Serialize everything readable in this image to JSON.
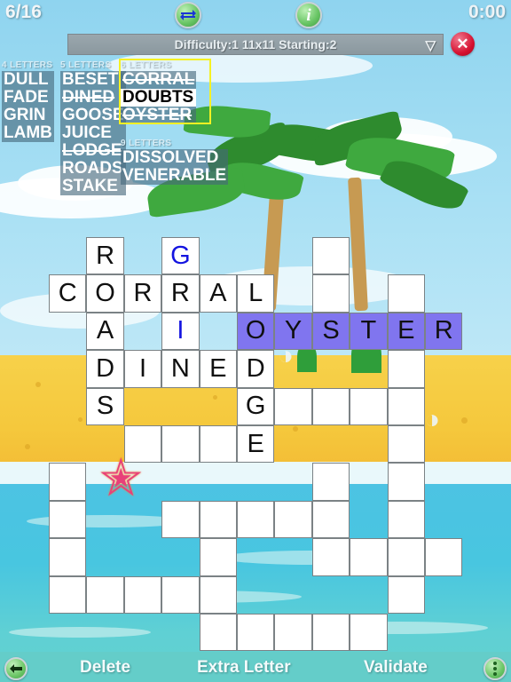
{
  "hud": {
    "progress": "6/16",
    "timer": "0:00",
    "swap_icon": "swap-arrows-icon",
    "info_icon": "info-icon",
    "info_glyph": "i",
    "close_icon": "close-icon",
    "close_glyph": "✕"
  },
  "dropdown": {
    "label": "Difficulty:1   11x11   Starting:2",
    "caret": "▽"
  },
  "wordbank": {
    "groups": [
      {
        "header": "4 LETTERS",
        "words": [
          {
            "text": "DULL",
            "used": false,
            "current": false
          },
          {
            "text": "FADE",
            "used": false,
            "current": false
          },
          {
            "text": "GRIN",
            "used": false,
            "current": false
          },
          {
            "text": "LAMB",
            "used": false,
            "current": false
          }
        ]
      },
      {
        "header": "5 LETTERS",
        "words": [
          {
            "text": "BESET",
            "used": false,
            "current": false
          },
          {
            "text": "DINED",
            "used": true,
            "current": false
          },
          {
            "text": "GOOSE",
            "used": false,
            "current": false
          },
          {
            "text": "JUICE",
            "used": false,
            "current": false
          },
          {
            "text": "LODGE",
            "used": true,
            "current": false
          },
          {
            "text": "ROADS",
            "used": false,
            "current": false
          },
          {
            "text": "STAKE",
            "used": false,
            "current": false
          }
        ]
      },
      {
        "header": "6 LETTERS",
        "words": [
          {
            "text": "CORRAL",
            "used": true,
            "current": false
          },
          {
            "text": "DOUBTS",
            "used": false,
            "current": true
          },
          {
            "text": "OYSTER",
            "used": true,
            "current": false
          }
        ]
      },
      {
        "header": "9 LETTERS",
        "words": [
          {
            "text": "DISSOLVED",
            "used": false,
            "current": false
          },
          {
            "text": "VENERABLE",
            "used": false,
            "current": false
          }
        ]
      }
    ],
    "highlight_color": "#f6f123"
  },
  "grid": {
    "rows": 11,
    "cols": 11,
    "selection_color": "#8075ef",
    "cells": [
      {
        "r": 0,
        "c": 1,
        "letter": "R",
        "state": "normal"
      },
      {
        "r": 0,
        "c": 3,
        "letter": "G",
        "state": "hint"
      },
      {
        "r": 0,
        "c": 7,
        "letter": "",
        "state": "normal"
      },
      {
        "r": 1,
        "c": 0,
        "letter": "C",
        "state": "normal"
      },
      {
        "r": 1,
        "c": 1,
        "letter": "O",
        "state": "normal"
      },
      {
        "r": 1,
        "c": 2,
        "letter": "R",
        "state": "normal"
      },
      {
        "r": 1,
        "c": 3,
        "letter": "R",
        "state": "normal"
      },
      {
        "r": 1,
        "c": 4,
        "letter": "A",
        "state": "normal"
      },
      {
        "r": 1,
        "c": 5,
        "letter": "L",
        "state": "normal"
      },
      {
        "r": 1,
        "c": 7,
        "letter": "",
        "state": "normal"
      },
      {
        "r": 1,
        "c": 9,
        "letter": "",
        "state": "normal"
      },
      {
        "r": 2,
        "c": 1,
        "letter": "A",
        "state": "normal"
      },
      {
        "r": 2,
        "c": 3,
        "letter": "I",
        "state": "hint"
      },
      {
        "r": 2,
        "c": 5,
        "letter": "O",
        "state": "selected"
      },
      {
        "r": 2,
        "c": 6,
        "letter": "Y",
        "state": "selected"
      },
      {
        "r": 2,
        "c": 7,
        "letter": "S",
        "state": "selected"
      },
      {
        "r": 2,
        "c": 8,
        "letter": "T",
        "state": "selected"
      },
      {
        "r": 2,
        "c": 9,
        "letter": "E",
        "state": "selected"
      },
      {
        "r": 2,
        "c": 10,
        "letter": "R",
        "state": "selected"
      },
      {
        "r": 3,
        "c": 1,
        "letter": "D",
        "state": "normal"
      },
      {
        "r": 3,
        "c": 2,
        "letter": "I",
        "state": "normal"
      },
      {
        "r": 3,
        "c": 3,
        "letter": "N",
        "state": "normal"
      },
      {
        "r": 3,
        "c": 4,
        "letter": "E",
        "state": "normal"
      },
      {
        "r": 3,
        "c": 5,
        "letter": "D",
        "state": "normal"
      },
      {
        "r": 3,
        "c": 9,
        "letter": "",
        "state": "normal"
      },
      {
        "r": 4,
        "c": 1,
        "letter": "S",
        "state": "normal"
      },
      {
        "r": 4,
        "c": 5,
        "letter": "G",
        "state": "normal"
      },
      {
        "r": 4,
        "c": 6,
        "letter": "",
        "state": "normal"
      },
      {
        "r": 4,
        "c": 7,
        "letter": "",
        "state": "normal"
      },
      {
        "r": 4,
        "c": 8,
        "letter": "",
        "state": "normal"
      },
      {
        "r": 4,
        "c": 9,
        "letter": "",
        "state": "normal"
      },
      {
        "r": 5,
        "c": 2,
        "letter": "",
        "state": "normal"
      },
      {
        "r": 5,
        "c": 3,
        "letter": "",
        "state": "normal"
      },
      {
        "r": 5,
        "c": 4,
        "letter": "",
        "state": "normal"
      },
      {
        "r": 5,
        "c": 5,
        "letter": "E",
        "state": "normal"
      },
      {
        "r": 5,
        "c": 9,
        "letter": "",
        "state": "normal"
      },
      {
        "r": 6,
        "c": 0,
        "letter": "",
        "state": "normal"
      },
      {
        "r": 6,
        "c": 7,
        "letter": "",
        "state": "normal"
      },
      {
        "r": 6,
        "c": 9,
        "letter": "",
        "state": "normal"
      },
      {
        "r": 7,
        "c": 0,
        "letter": "",
        "state": "normal"
      },
      {
        "r": 7,
        "c": 3,
        "letter": "",
        "state": "normal"
      },
      {
        "r": 7,
        "c": 4,
        "letter": "",
        "state": "normal"
      },
      {
        "r": 7,
        "c": 5,
        "letter": "",
        "state": "normal"
      },
      {
        "r": 7,
        "c": 6,
        "letter": "",
        "state": "normal"
      },
      {
        "r": 7,
        "c": 7,
        "letter": "",
        "state": "normal"
      },
      {
        "r": 7,
        "c": 9,
        "letter": "",
        "state": "normal"
      },
      {
        "r": 8,
        "c": 0,
        "letter": "",
        "state": "normal"
      },
      {
        "r": 8,
        "c": 4,
        "letter": "",
        "state": "normal"
      },
      {
        "r": 8,
        "c": 7,
        "letter": "",
        "state": "normal"
      },
      {
        "r": 8,
        "c": 8,
        "letter": "",
        "state": "normal"
      },
      {
        "r": 8,
        "c": 9,
        "letter": "",
        "state": "normal"
      },
      {
        "r": 8,
        "c": 10,
        "letter": "",
        "state": "normal"
      },
      {
        "r": 9,
        "c": 0,
        "letter": "",
        "state": "normal"
      },
      {
        "r": 9,
        "c": 1,
        "letter": "",
        "state": "normal"
      },
      {
        "r": 9,
        "c": 2,
        "letter": "",
        "state": "normal"
      },
      {
        "r": 9,
        "c": 3,
        "letter": "",
        "state": "normal"
      },
      {
        "r": 9,
        "c": 4,
        "letter": "",
        "state": "normal"
      },
      {
        "r": 9,
        "c": 9,
        "letter": "",
        "state": "normal"
      },
      {
        "r": 10,
        "c": 4,
        "letter": "",
        "state": "normal"
      },
      {
        "r": 10,
        "c": 5,
        "letter": "",
        "state": "normal"
      },
      {
        "r": 10,
        "c": 6,
        "letter": "",
        "state": "normal"
      },
      {
        "r": 10,
        "c": 7,
        "letter": "",
        "state": "normal"
      },
      {
        "r": 10,
        "c": 8,
        "letter": "",
        "state": "normal"
      }
    ]
  },
  "bottombar": {
    "back_icon": "back-arrow-icon",
    "back_glyph": "⬅",
    "delete_label": "Delete",
    "extra_letter_label": "Extra Letter",
    "validate_label": "Validate",
    "menu_icon": "more-options-icon"
  }
}
